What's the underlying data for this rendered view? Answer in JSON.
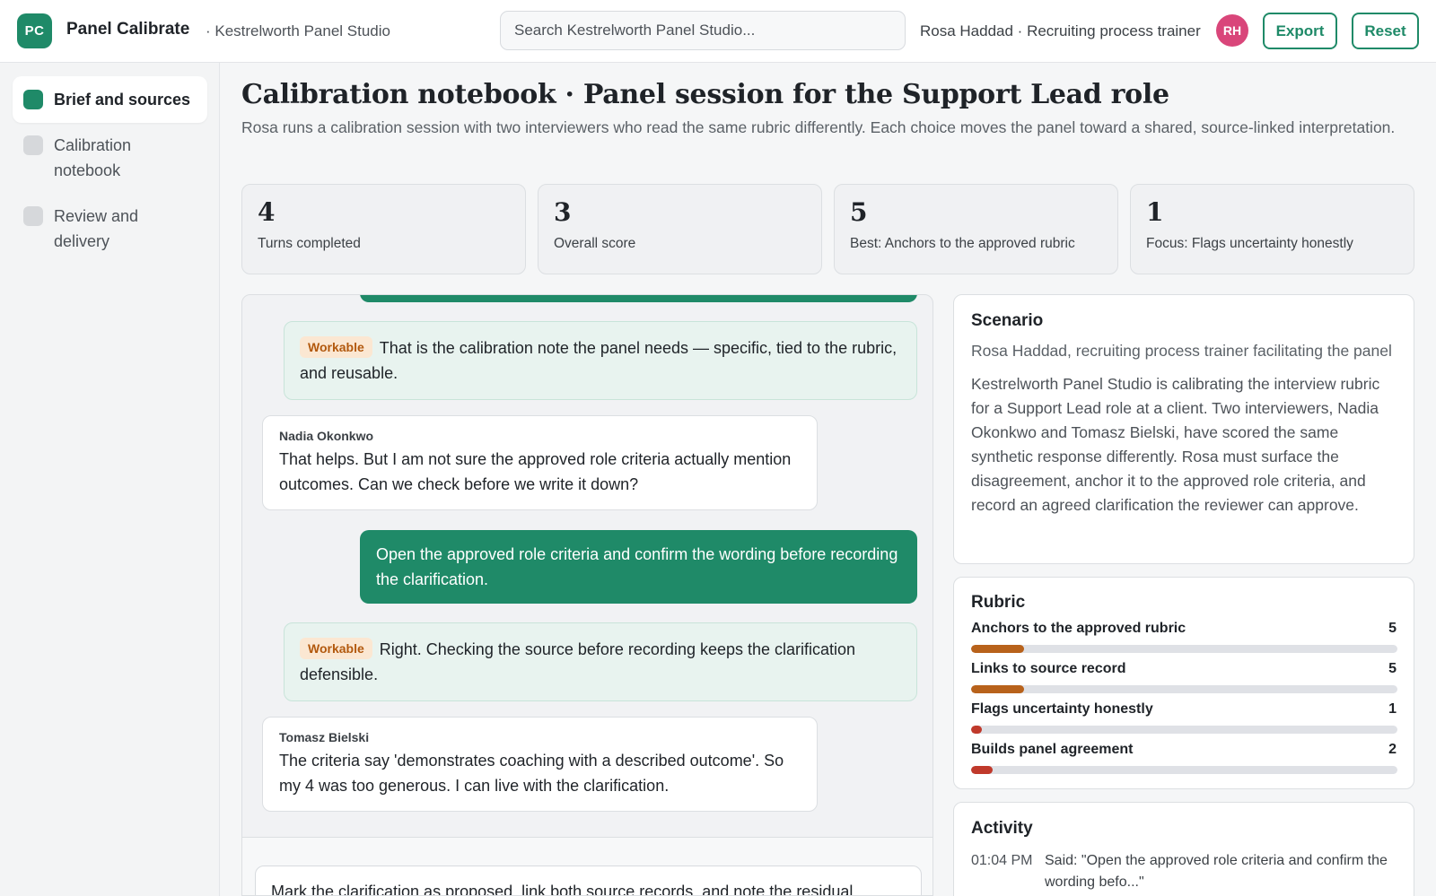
{
  "header": {
    "logo_text": "PC",
    "app_name": "Panel Calibrate",
    "workspace": "· Kestrelworth Panel Studio",
    "search_placeholder": "Search Kestrelworth Panel Studio...",
    "user_line": "Rosa Haddad · Recruiting process trainer",
    "avatar_initials": "RH",
    "export_label": "Export",
    "reset_label": "Reset"
  },
  "sidebar": {
    "items": [
      {
        "label": "Brief and sources",
        "active": true
      },
      {
        "label": "Calibration notebook",
        "active": false
      },
      {
        "label": "Review and delivery",
        "active": false
      }
    ]
  },
  "page": {
    "title": "Calibration notebook · Panel session for the Support Lead role",
    "subtitle": "Rosa runs a calibration session with two interviewers who read the same rubric differently. Each choice moves the panel toward a shared, source-linked interpretation."
  },
  "stats": [
    {
      "value": "4",
      "label": "Turns completed"
    },
    {
      "value": "3",
      "label": "Overall score"
    },
    {
      "value": "5",
      "label": "Best: Anchors to the approved rubric"
    },
    {
      "value": "1",
      "label": "Focus: Flags uncertainty honestly"
    }
  ],
  "chat": {
    "coach_1": {
      "badge": "Workable",
      "text": "That is the calibration note the panel needs — specific, tied to the rubric, and reusable."
    },
    "npc_1": {
      "name": "Nadia Okonkwo",
      "text": "That helps. But I am not sure the approved role criteria actually mention outcomes. Can we check before we write it down?"
    },
    "user_1": "Open the approved role criteria and confirm the wording before recording the clarification.",
    "coach_2": {
      "badge": "Workable",
      "text": "Right. Checking the source before recording keeps the clarification defensible."
    },
    "npc_2": {
      "name": "Tomasz Bielski",
      "text": "The criteria say 'demonstrates coaching with a described outcome'. So my 4 was too generous. I can live with the clarification."
    },
    "composer_text": "Mark the clarification as proposed, link both source records, and note the residual"
  },
  "scenario": {
    "title": "Scenario",
    "lead": "Rosa Haddad, recruiting process trainer facilitating the panel",
    "body": "Kestrelworth Panel Studio is calibrating the interview rubric for a Support Lead role at a client. Two interviewers, Nadia Okonkwo and Tomasz Bielski, have scored the same synthetic response differently. Rosa must surface the disagreement, anchor it to the approved role criteria, and record an agreed clarification the reviewer can approve."
  },
  "rubric": {
    "title": "Rubric",
    "max": 40,
    "items": [
      {
        "label": "Anchors to the approved rubric",
        "value": 5,
        "color": "#b8621b"
      },
      {
        "label": "Links to source record",
        "value": 5,
        "color": "#b8621b"
      },
      {
        "label": "Flags uncertainty honestly",
        "value": 1,
        "color": "#c0392b"
      },
      {
        "label": "Builds panel agreement",
        "value": 2,
        "color": "#c0392b"
      }
    ]
  },
  "activity": {
    "title": "Activity",
    "items": [
      {
        "time": "01:04 PM",
        "text": "Said: \"Open the approved role criteria and confirm the wording befo...\""
      }
    ]
  }
}
